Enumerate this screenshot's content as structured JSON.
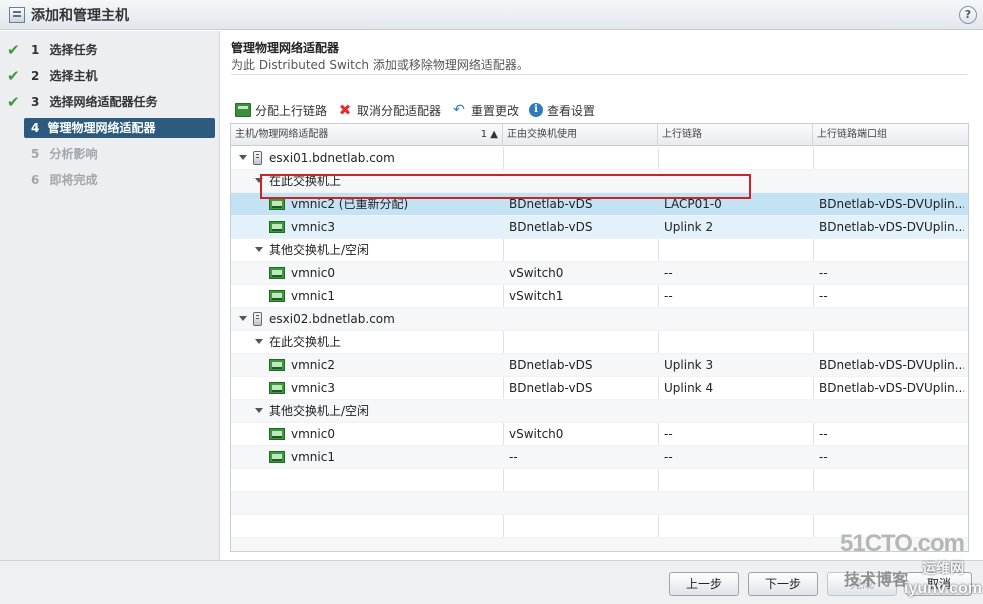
{
  "window": {
    "title": "添加和管理主机",
    "help": "?"
  },
  "steps": [
    {
      "num": "1",
      "label": "选择任务",
      "state": "done"
    },
    {
      "num": "2",
      "label": "选择主机",
      "state": "done"
    },
    {
      "num": "3",
      "label": "选择网络适配器任务",
      "state": "done"
    },
    {
      "num": "4",
      "label": "管理物理网络适配器",
      "state": "active"
    },
    {
      "num": "5",
      "label": "分析影响",
      "state": "disabled"
    },
    {
      "num": "6",
      "label": "即将完成",
      "state": "disabled"
    }
  ],
  "page": {
    "heading": "管理物理网络适配器",
    "subheading": "为此 Distributed Switch 添加或移除物理网络适配器。"
  },
  "toolbar": {
    "assign": "分配上行链路",
    "unassign": "取消分配适配器",
    "reset": "重置更改",
    "view_settings": "查看设置"
  },
  "table": {
    "columns": [
      "主机/物理网络适配器",
      "正由交换机使用",
      "上行链路",
      "上行链路端口组"
    ],
    "sort_indicator": "1 ▲",
    "rows": [
      {
        "type": "host",
        "name": "esxi01.bdnetlab.com",
        "switch": "",
        "uplink": "",
        "portgroup": ""
      },
      {
        "type": "group",
        "name": "在此交换机上",
        "switch": "",
        "uplink": "",
        "portgroup": ""
      },
      {
        "type": "nic",
        "name": "vmnic2 (已重新分配)",
        "switch": "BDnetlab-vDS",
        "uplink": "LACP01-0",
        "portgroup": "BDnetlab-vDS-DVUplin...",
        "state": "selected"
      },
      {
        "type": "nic",
        "name": "vmnic3",
        "switch": "BDnetlab-vDS",
        "uplink": "Uplink 2",
        "portgroup": "BDnetlab-vDS-DVUplin...",
        "state": "hover"
      },
      {
        "type": "group",
        "name": "其他交换机上/空闲",
        "switch": "",
        "uplink": "",
        "portgroup": ""
      },
      {
        "type": "nic",
        "name": "vmnic0",
        "switch": "vSwitch0",
        "uplink": "--",
        "portgroup": "--"
      },
      {
        "type": "nic",
        "name": "vmnic1",
        "switch": "vSwitch1",
        "uplink": "--",
        "portgroup": "--"
      },
      {
        "type": "host",
        "name": "esxi02.bdnetlab.com",
        "switch": "",
        "uplink": "",
        "portgroup": ""
      },
      {
        "type": "group",
        "name": "在此交换机上",
        "switch": "",
        "uplink": "",
        "portgroup": ""
      },
      {
        "type": "nic",
        "name": "vmnic2",
        "switch": "BDnetlab-vDS",
        "uplink": "Uplink 3",
        "portgroup": "BDnetlab-vDS-DVUplin..."
      },
      {
        "type": "nic",
        "name": "vmnic3",
        "switch": "BDnetlab-vDS",
        "uplink": "Uplink 4",
        "portgroup": "BDnetlab-vDS-DVUplin..."
      },
      {
        "type": "group",
        "name": "其他交换机上/空闲",
        "switch": "",
        "uplink": "",
        "portgroup": ""
      },
      {
        "type": "nic",
        "name": "vmnic0",
        "switch": "vSwitch0",
        "uplink": "--",
        "portgroup": "--"
      },
      {
        "type": "nic",
        "name": "vmnic1",
        "switch": "--",
        "uplink": "--",
        "portgroup": "--"
      }
    ]
  },
  "footer": {
    "back": "上一步",
    "next": "下一步",
    "finish": "完成",
    "cancel": "取消"
  },
  "watermark": {
    "site": "51CTO.com",
    "blog": "技术博客",
    "brand": "运维网",
    "url": "iyunv.com"
  },
  "colors": {
    "accent": "#2b5a7d",
    "selected_row": "#c3e3f5",
    "highlight_box": "#c8252b",
    "check": "#3d9a3d"
  }
}
